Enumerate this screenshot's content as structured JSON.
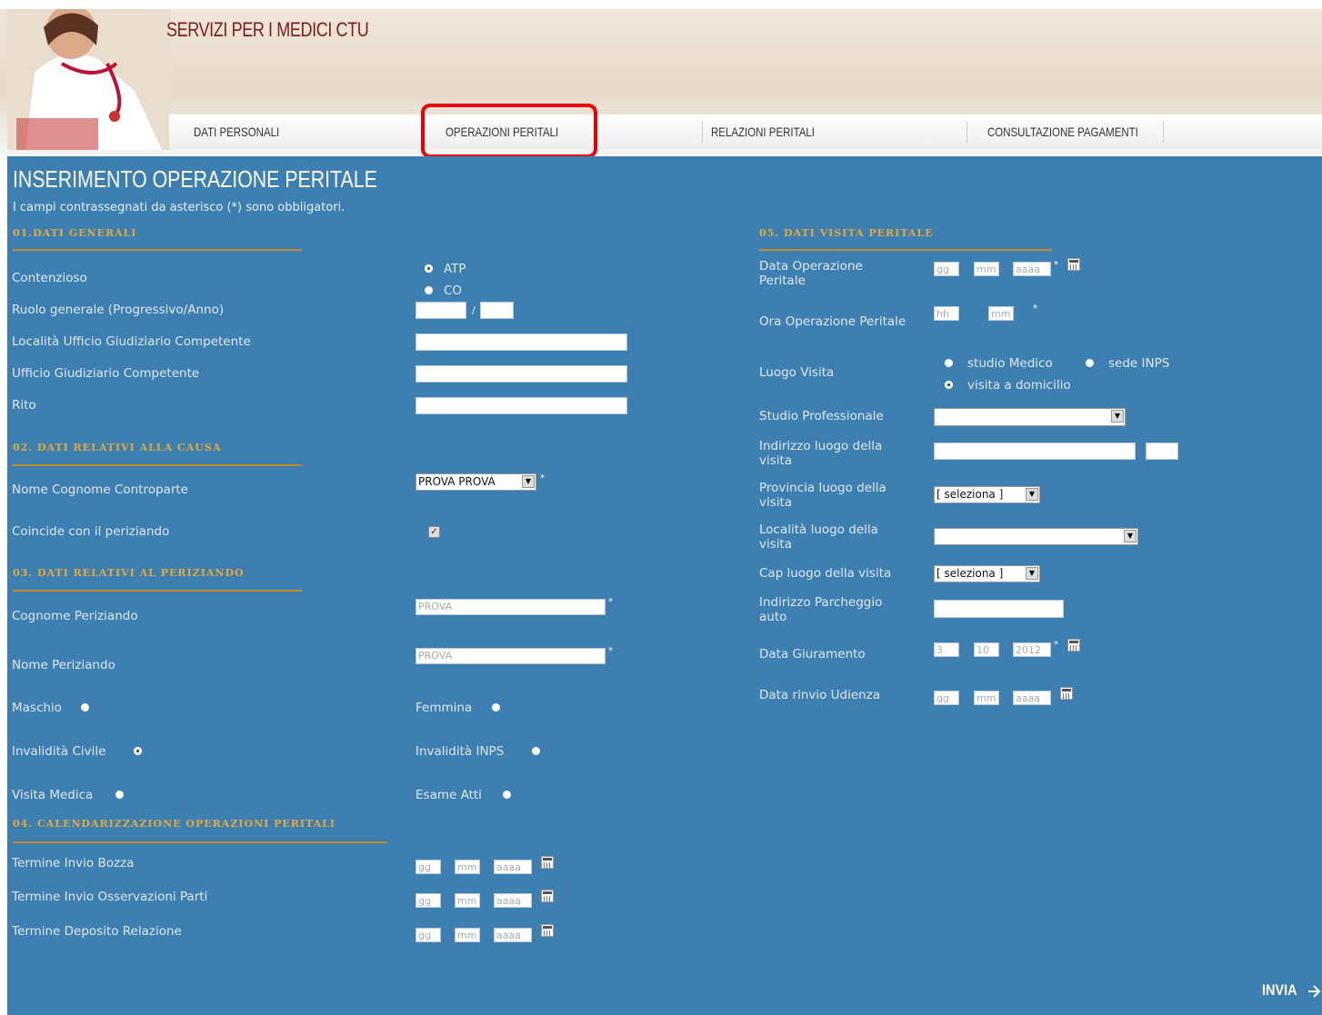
{
  "header": {
    "title": "SERVIZI PER I MEDICI CTU",
    "nav": [
      "DATI PERSONALI",
      "OPERAZIONI PERITALI",
      "RELAZIONI PERITALI",
      "CONSULTAZIONE PAGAMENTI"
    ],
    "highlighted_tab": "OPERAZIONI PERITALI"
  },
  "page": {
    "title": "INSERIMENTO OPERAZIONE PERITALE",
    "note": "I campi contrassegnati da asterisco (*) sono obbligatori.",
    "submit_label": "INVIA"
  },
  "section1": {
    "title": "01.DATI GENERALI",
    "contenzioso_label": "Contenzioso",
    "contenzioso_options": [
      "ATP",
      "CO"
    ],
    "contenzioso_selected": "ATP",
    "ruolo_label": "Ruolo generale (Progressivo/Anno)",
    "ruolo_sep": "/",
    "localita_label": "Località Ufficio Giudiziario Competente",
    "ufficio_label": "Ufficio Giudiziario Competente",
    "rito_label": "Rito"
  },
  "section2": {
    "title": "02. DATI RELATIVI ALLA CAUSA",
    "controparte_label": "Nome Cognome Controparte",
    "controparte_value": "PROVA PROVA",
    "coincide_label": "Coincide con il periziando",
    "coincide_checked": true
  },
  "section3": {
    "title": "03. DATI RELATIVI AL PERIZIANDO",
    "cognome_label": "Cognome Periziando",
    "cognome_value": "PROVA",
    "nome_label": "Nome Periziando",
    "nome_value": "PROVA",
    "maschio_label": "Maschio",
    "femmina_label": "Femmina",
    "inv_civile_label": "Invalidità Civile",
    "inv_inps_label": "Invalidità INPS",
    "visita_medica_label": "Visita Medica",
    "esame_atti_label": "Esame Atti"
  },
  "section4": {
    "title": "04. CALENDARIZZAZIONE OPERAZIONI PERITALI",
    "rows": [
      "Termine Invio Bozza",
      "Termine Invio Osservazioni Parti",
      "Termine Deposito Relazione"
    ]
  },
  "date_placeholders": {
    "day": "gg",
    "month": "mm",
    "year": "aaaa",
    "hour": "hh",
    "minute": "mm"
  },
  "section5": {
    "title": "05. DATI VISITA PERITALE",
    "data_op_label": "Data Operazione Peritale",
    "ora_op_label": "Ora Operazione Peritale",
    "luogo_label": "Luogo Visita",
    "luogo_options": [
      "studio Medico",
      "sede INPS",
      "visita a domicilio"
    ],
    "luogo_selected": "visita a domicilio",
    "studio_label": "Studio Professionale",
    "indirizzo_label": "Indirizzo luogo della visita",
    "provincia_label": "Provincia luogo della visita",
    "provincia_value": "[ seleziona ]",
    "localita_label": "Località luogo della visita",
    "cap_label": "Cap luogo della visita",
    "cap_value": "[ seleziona ]",
    "parcheggio_label": "Indirizzo Parcheggio auto",
    "giuramento_label": "Data Giuramento",
    "giuramento_day": "3",
    "giuramento_month": "10",
    "giuramento_year": "2012",
    "rinvio_label": "Data rinvio Udienza"
  }
}
